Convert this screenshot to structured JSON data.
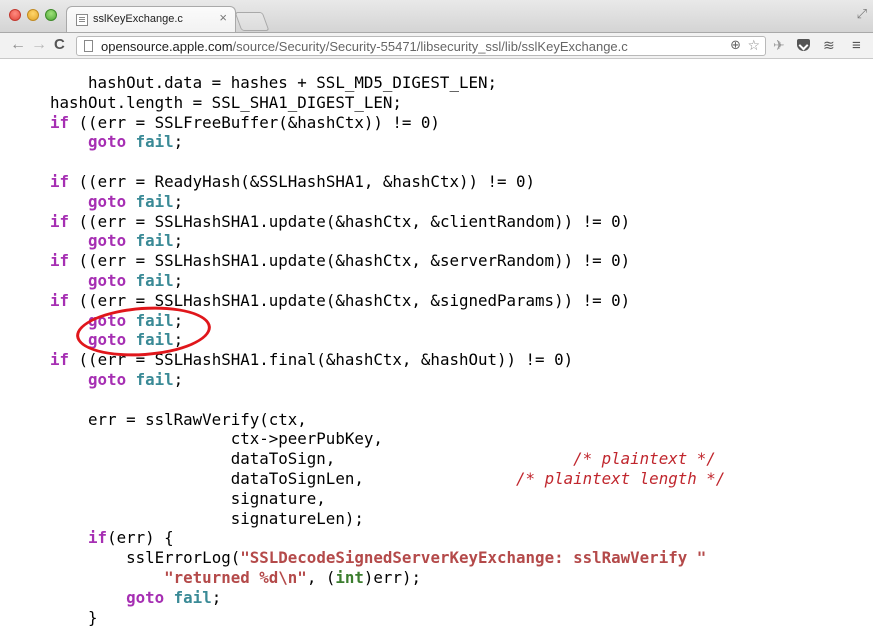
{
  "window": {
    "tab_title": "sslKeyExchange.c",
    "tab_close": "×"
  },
  "toolbar": {
    "back": "←",
    "forward": "→",
    "reload": "C",
    "url_scheme": "",
    "url_host": "opensource.apple.com",
    "url_path": "/source/Security/Security-55471/libsecurity_ssl/lib/sslKeyExchange.c"
  },
  "icons": {
    "zoom": "⊕",
    "star": "☆",
    "ext1": "✈",
    "ext3": "≋",
    "menu": "≡",
    "fullscreen": "⤢"
  },
  "code_lines": [
    {
      "indent": "    ",
      "segments": [
        {
          "t": "hashOut.data = hashes + SSL_MD5_DIGEST_LEN;",
          "c": ""
        }
      ]
    },
    {
      "indent": "",
      "segments": [
        {
          "t": "hashOut.length = SSL_SHA1_DIGEST_LEN;",
          "c": ""
        }
      ]
    },
    {
      "indent": "",
      "segments": [
        {
          "t": "if",
          "c": "kw"
        },
        {
          "t": " ((err = SSLFreeBuffer(&hashCtx)) != 0)",
          "c": ""
        }
      ]
    },
    {
      "indent": "    ",
      "segments": [
        {
          "t": "goto",
          "c": "kw"
        },
        {
          "t": " ",
          "c": ""
        },
        {
          "t": "fail",
          "c": "fn"
        },
        {
          "t": ";",
          "c": ""
        }
      ]
    },
    {
      "indent": "",
      "segments": [
        {
          "t": "",
          "c": ""
        }
      ]
    },
    {
      "indent": "",
      "segments": [
        {
          "t": "if",
          "c": "kw"
        },
        {
          "t": " ((err = ReadyHash(&SSLHashSHA1, &hashCtx)) != 0)",
          "c": ""
        }
      ]
    },
    {
      "indent": "    ",
      "segments": [
        {
          "t": "goto",
          "c": "kw"
        },
        {
          "t": " ",
          "c": ""
        },
        {
          "t": "fail",
          "c": "fn"
        },
        {
          "t": ";",
          "c": ""
        }
      ]
    },
    {
      "indent": "",
      "segments": [
        {
          "t": "if",
          "c": "kw"
        },
        {
          "t": " ((err = SSLHashSHA1.update(&hashCtx, &clientRandom)) != 0)",
          "c": ""
        }
      ]
    },
    {
      "indent": "    ",
      "segments": [
        {
          "t": "goto",
          "c": "kw"
        },
        {
          "t": " ",
          "c": ""
        },
        {
          "t": "fail",
          "c": "fn"
        },
        {
          "t": ";",
          "c": ""
        }
      ]
    },
    {
      "indent": "",
      "segments": [
        {
          "t": "if",
          "c": "kw"
        },
        {
          "t": " ((err = SSLHashSHA1.update(&hashCtx, &serverRandom)) != 0)",
          "c": ""
        }
      ]
    },
    {
      "indent": "    ",
      "segments": [
        {
          "t": "goto",
          "c": "kw"
        },
        {
          "t": " ",
          "c": ""
        },
        {
          "t": "fail",
          "c": "fn"
        },
        {
          "t": ";",
          "c": ""
        }
      ]
    },
    {
      "indent": "",
      "segments": [
        {
          "t": "if",
          "c": "kw"
        },
        {
          "t": " ((err = SSLHashSHA1.update(&hashCtx, &signedParams)) != 0)",
          "c": ""
        }
      ]
    },
    {
      "indent": "    ",
      "segments": [
        {
          "t": "goto",
          "c": "kw"
        },
        {
          "t": " ",
          "c": ""
        },
        {
          "t": "fail",
          "c": "fn"
        },
        {
          "t": ";",
          "c": ""
        }
      ]
    },
    {
      "indent": "    ",
      "segments": [
        {
          "t": "goto",
          "c": "kw"
        },
        {
          "t": " ",
          "c": ""
        },
        {
          "t": "fail",
          "c": "fn"
        },
        {
          "t": ";",
          "c": ""
        }
      ]
    },
    {
      "indent": "",
      "segments": [
        {
          "t": "if",
          "c": "kw"
        },
        {
          "t": " ((err = SSLHashSHA1.final(&hashCtx, &hashOut)) != 0)",
          "c": ""
        }
      ]
    },
    {
      "indent": "    ",
      "segments": [
        {
          "t": "goto",
          "c": "kw"
        },
        {
          "t": " ",
          "c": ""
        },
        {
          "t": "fail",
          "c": "fn"
        },
        {
          "t": ";",
          "c": ""
        }
      ]
    },
    {
      "indent": "",
      "segments": [
        {
          "t": "",
          "c": ""
        }
      ]
    },
    {
      "indent": "    ",
      "segments": [
        {
          "t": "err = sslRawVerify(ctx,",
          "c": ""
        }
      ]
    },
    {
      "indent": "                   ",
      "segments": [
        {
          "t": "ctx->peerPubKey,",
          "c": ""
        }
      ]
    },
    {
      "indent": "                   ",
      "segments": [
        {
          "t": "dataToSign,",
          "c": ""
        },
        {
          "t": "                         ",
          "c": ""
        },
        {
          "t": "/* plaintext */",
          "c": "cm"
        }
      ]
    },
    {
      "indent": "                   ",
      "segments": [
        {
          "t": "dataToSignLen,",
          "c": ""
        },
        {
          "t": "                ",
          "c": ""
        },
        {
          "t": "/* plaintext length */",
          "c": "cm"
        }
      ]
    },
    {
      "indent": "                   ",
      "segments": [
        {
          "t": "signature,",
          "c": ""
        }
      ]
    },
    {
      "indent": "                   ",
      "segments": [
        {
          "t": "signatureLen);",
          "c": ""
        }
      ]
    },
    {
      "indent": "    ",
      "segments": [
        {
          "t": "if",
          "c": "kw"
        },
        {
          "t": "(err) {",
          "c": ""
        }
      ]
    },
    {
      "indent": "        ",
      "segments": [
        {
          "t": "sslErrorLog(",
          "c": ""
        },
        {
          "t": "\"SSLDecodeSignedServerKeyExchange: sslRawVerify \"",
          "c": "str"
        }
      ]
    },
    {
      "indent": "            ",
      "segments": [
        {
          "t": "\"returned %d\\n\"",
          "c": "str"
        },
        {
          "t": ", (",
          "c": ""
        },
        {
          "t": "int",
          "c": "typ"
        },
        {
          "t": ")err);",
          "c": ""
        }
      ]
    },
    {
      "indent": "        ",
      "segments": [
        {
          "t": "goto",
          "c": "kw"
        },
        {
          "t": " ",
          "c": ""
        },
        {
          "t": "fail",
          "c": "fn"
        },
        {
          "t": ";",
          "c": ""
        }
      ]
    },
    {
      "indent": "    ",
      "segments": [
        {
          "t": "}",
          "c": ""
        }
      ]
    }
  ]
}
